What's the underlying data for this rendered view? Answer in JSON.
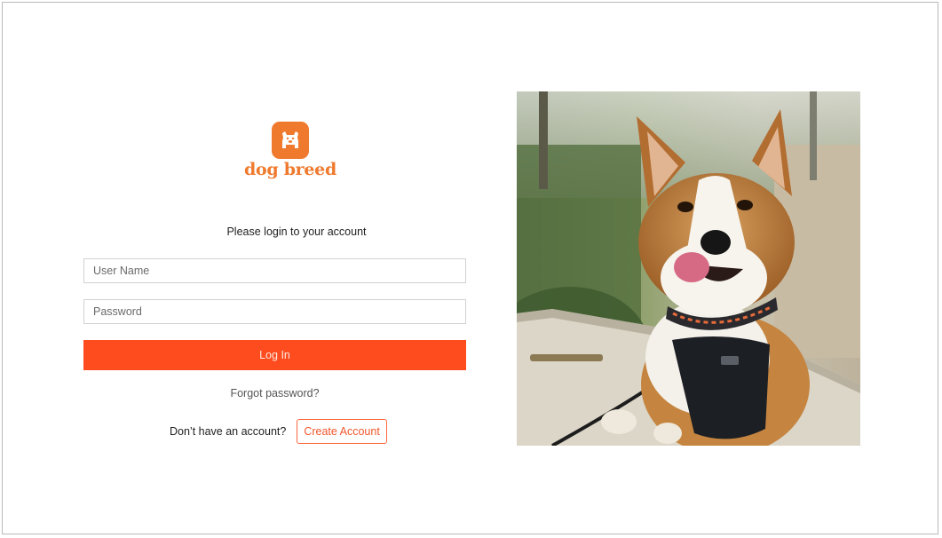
{
  "brand": {
    "name": "dog breed",
    "icon": "bulldog-icon",
    "color": "#ef7a2e"
  },
  "login": {
    "subtitle": "Please login to your account",
    "username_placeholder": "User Name",
    "password_placeholder": "Password",
    "login_label": "Log In",
    "forgot_label": "Forgot password?",
    "signup_prompt": "Don’t have an account?",
    "create_label": "Create Account",
    "accent": "#ff4c1f"
  },
  "hero": {
    "image": "corgi-photo"
  }
}
